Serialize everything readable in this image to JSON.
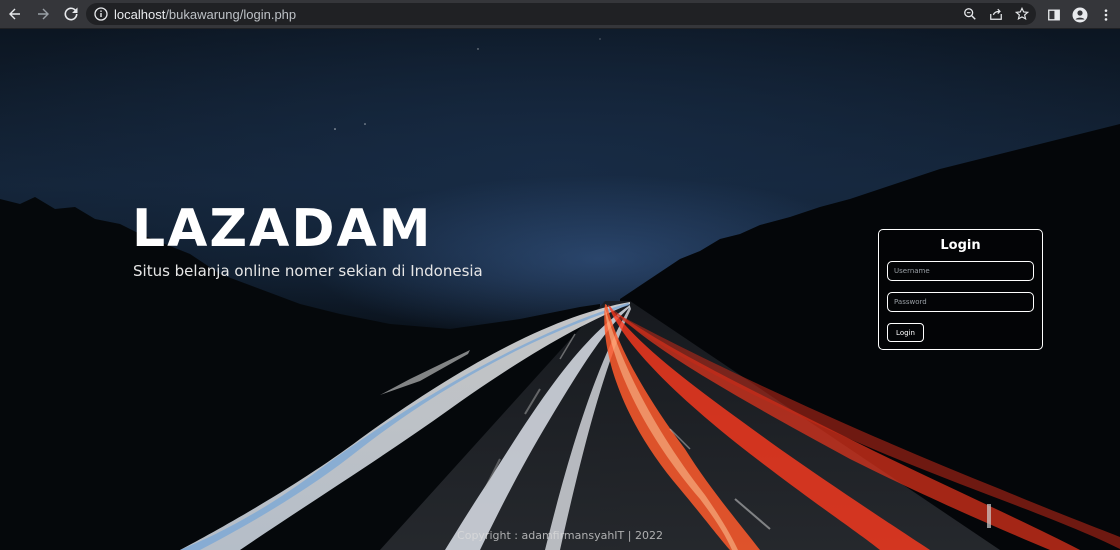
{
  "browser": {
    "url_host": "localhost",
    "url_path": "/bukawarung/login.php",
    "icons": [
      "back-icon",
      "forward-icon",
      "reload-icon",
      "info-icon",
      "zoom-icon",
      "share-icon",
      "star-icon",
      "sidepanel-icon",
      "profile-icon",
      "menu-icon"
    ]
  },
  "hero": {
    "title": "LAZADAM",
    "tagline": "Situs belanja online nomer sekian di Indonesia"
  },
  "login": {
    "title": "Login",
    "username_placeholder": "Username",
    "password_placeholder": "Password",
    "button_label": "Login"
  },
  "footer": {
    "text": "Copyright : adamfirmansyahIT | 2022"
  },
  "colors": {
    "chrome_bg": "#35363a",
    "omnibox_bg": "#202124",
    "text_white": "#ffffff",
    "sky_dark": "#0c1622"
  }
}
